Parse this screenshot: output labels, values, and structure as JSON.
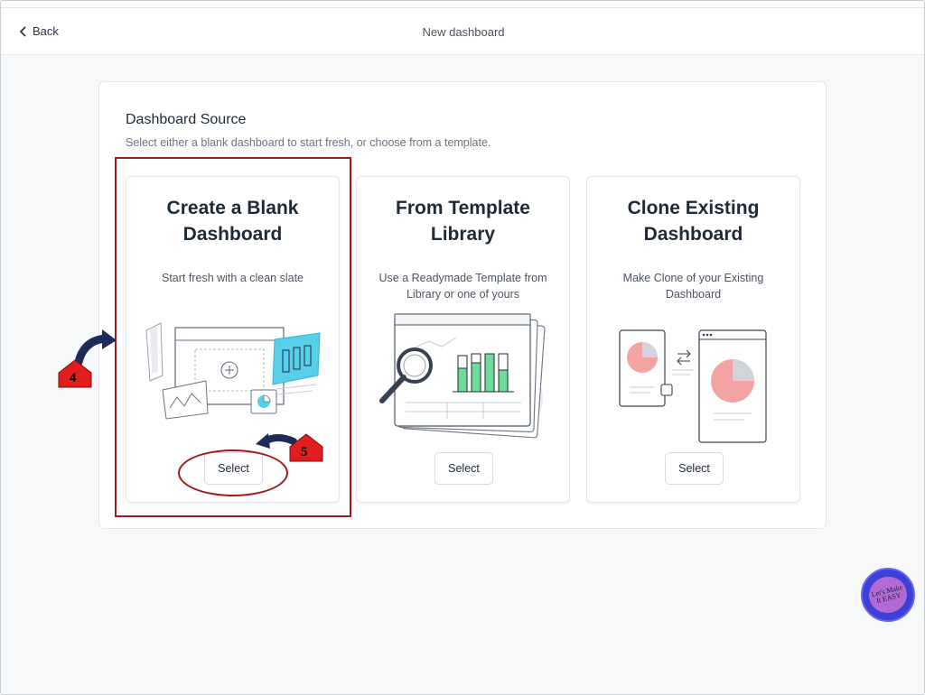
{
  "header": {
    "back_label": "Back",
    "title": "New dashboard"
  },
  "panel": {
    "title": "Dashboard Source",
    "subtitle": "Select either a blank dashboard to start fresh, or choose from a template."
  },
  "cards": [
    {
      "heading_line1": "Create a Blank",
      "heading_line2": "Dashboard",
      "description": "Start fresh with a clean slate",
      "button_label": "Select"
    },
    {
      "heading_line1": "From Template",
      "heading_line2": "Library",
      "description": "Use a Readymade Template from Library or one of yours",
      "button_label": "Select"
    },
    {
      "heading_line1": "Clone Existing",
      "heading_line2": "Dashboard",
      "description": "Make Clone of your Existing Dashboard",
      "button_label": "Select"
    }
  ],
  "annotations": {
    "step4": "4",
    "step5": "5",
    "color": "#a01c1c"
  },
  "fab": {
    "text": "Let's Make It EASY"
  },
  "colors": {
    "accent_teal": "#56d0e8",
    "accent_green": "#6fdc9a",
    "pie_pink": "#f4a3a3",
    "fab_blue": "#3d3fd6"
  }
}
